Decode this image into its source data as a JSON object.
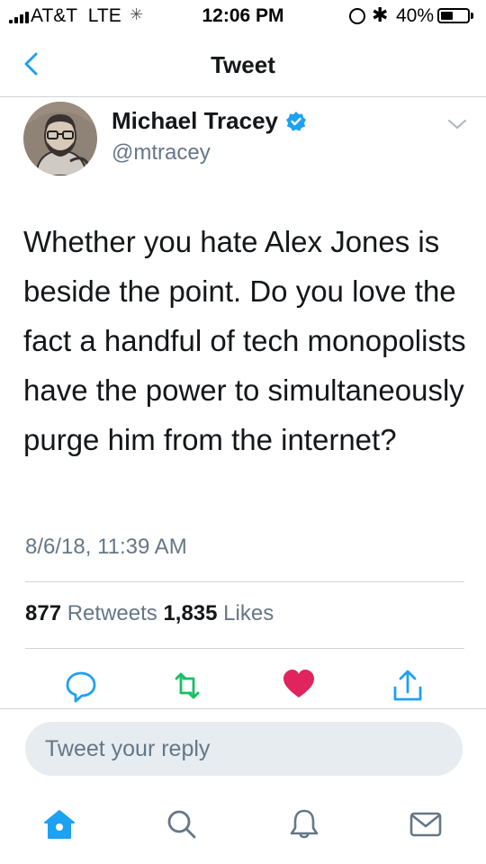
{
  "status_bar": {
    "carrier": "AT&T",
    "network": "LTE",
    "time": "12:06 PM",
    "battery": "40%",
    "battery_level": 0.4
  },
  "nav": {
    "back_icon": "chevron-left-icon",
    "title": "Tweet"
  },
  "tweet": {
    "author_name": "Michael Tracey",
    "verified": true,
    "handle": "@mtracey",
    "text": "Whether you hate Alex Jones is beside the point. Do you love the fact a handful of tech monopolists have the power to simultaneously purge him from the internet?",
    "timestamp": "8/6/18, 11:39 AM",
    "retweets_count": "877",
    "retweets_label": "Retweets",
    "likes_count": "1,835",
    "likes_label": "Likes"
  },
  "actions": [
    "reply-icon",
    "retweet-icon",
    "like-icon",
    "share-icon"
  ],
  "reply": {
    "placeholder": "Tweet your reply"
  },
  "tab_bar": [
    "home-icon",
    "search-icon",
    "notifications-icon",
    "messages-icon"
  ],
  "colors": {
    "accent": "#1da1f2",
    "retweet": "#17bf63",
    "like": "#e0245e",
    "secondary_text": "#657786",
    "reply_bg": "#e6ecf0"
  }
}
